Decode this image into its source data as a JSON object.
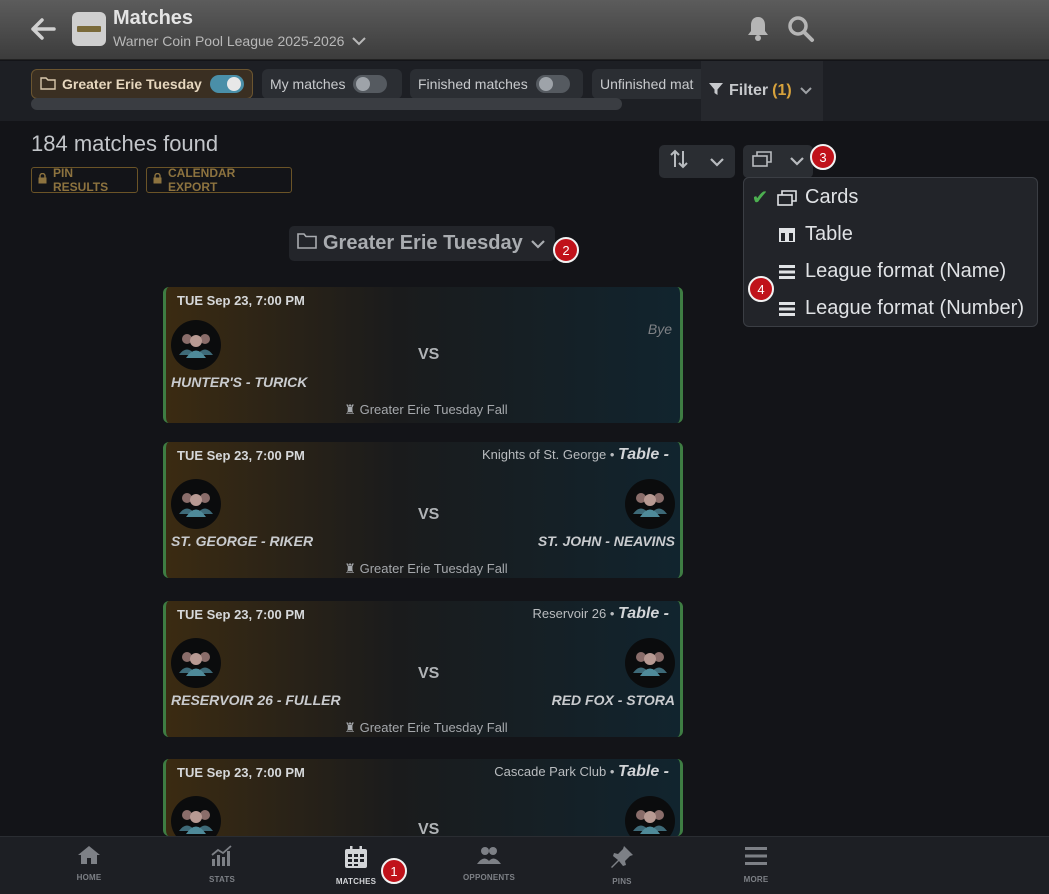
{
  "header": {
    "title": "Matches",
    "subtitle": "Warner Coin Pool League 2025-2026"
  },
  "chips": [
    {
      "label": "Greater Erie Tuesday",
      "on": true
    },
    {
      "label": "My matches",
      "on": false
    },
    {
      "label": "Finished matches",
      "on": false
    },
    {
      "label": "Unfinished mat",
      "on": false
    }
  ],
  "filter": {
    "label": "Filter",
    "count": "(1)"
  },
  "results": {
    "count_text": "184 matches found",
    "pin_label": "PIN RESULTS",
    "export_label": "CALENDAR EXPORT"
  },
  "view_menu": {
    "items": [
      {
        "label": "Cards",
        "selected": true,
        "icon": "cards-icon"
      },
      {
        "label": "Table",
        "selected": false,
        "icon": "table-icon"
      },
      {
        "label": "League format (Name)",
        "selected": false,
        "icon": "list-icon"
      },
      {
        "label": "League format (Number)",
        "selected": false,
        "icon": "list-icon"
      }
    ]
  },
  "group": {
    "label": "Greater Erie Tuesday"
  },
  "matches": [
    {
      "date": "TUE Sep 23, 7:00 PM",
      "venue": "",
      "table": "",
      "home": "HUNTER'S - TURICK",
      "away": "",
      "bye": "Bye",
      "vs": "VS",
      "season": "Greater Erie Tuesday Fall"
    },
    {
      "date": "TUE Sep 23, 7:00 PM",
      "venue": "Knights of St. George •",
      "table": "Table -",
      "home": "ST. GEORGE - RIKER",
      "away": "ST. JOHN - NEAVINS",
      "bye": "",
      "vs": "VS",
      "season": "Greater Erie Tuesday Fall"
    },
    {
      "date": "TUE Sep 23, 7:00 PM",
      "venue": "Reservoir 26 •",
      "table": "Table -",
      "home": "RESERVOIR 26 - FULLER",
      "away": "RED FOX - STORA",
      "bye": "",
      "vs": "VS",
      "season": "Greater Erie Tuesday Fall"
    },
    {
      "date": "TUE Sep 23, 7:00 PM",
      "venue": "Cascade Park Club •",
      "table": "Table -",
      "home": "",
      "away": "",
      "bye": "",
      "vs": "VS",
      "season": ""
    }
  ],
  "badges": [
    "1",
    "2",
    "3",
    "4"
  ],
  "nav": [
    {
      "label": "HOME",
      "icon": "home-icon"
    },
    {
      "label": "STATS",
      "icon": "stats-icon"
    },
    {
      "label": "MATCHES",
      "icon": "calendar-icon",
      "active": true
    },
    {
      "label": "OPPONENTS",
      "icon": "opponents-icon"
    },
    {
      "label": "PINS",
      "icon": "pin-icon"
    },
    {
      "label": "MORE",
      "icon": "menu-icon"
    }
  ],
  "colors": {
    "accent": "#d7a23c",
    "toggle_on": "#4a8fa8",
    "check": "#4caf50",
    "card_border": "#3e7d43",
    "badge": "#c0121a"
  }
}
